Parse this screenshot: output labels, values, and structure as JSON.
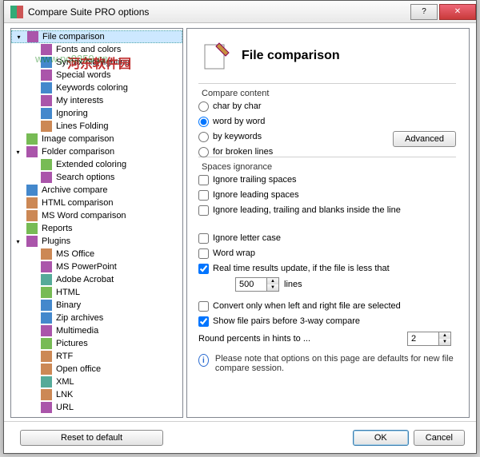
{
  "window": {
    "title": "Compare Suite PRO options"
  },
  "watermark": {
    "text": "www.pc0359.cn",
    "cn": "河东软件园"
  },
  "tree": [
    {
      "expand": "▾",
      "label": "File comparison",
      "lvl": 0,
      "sel": true
    },
    {
      "label": "Fonts and colors",
      "lvl": 1
    },
    {
      "label": "Syntax highlighting",
      "lvl": 1
    },
    {
      "label": "Special words",
      "lvl": 1
    },
    {
      "label": "Keywords coloring",
      "lvl": 1
    },
    {
      "label": "My interests",
      "lvl": 1
    },
    {
      "label": "Ignoring",
      "lvl": 1
    },
    {
      "label": "Lines Folding",
      "lvl": 1
    },
    {
      "label": "Image comparison",
      "lvl": 0
    },
    {
      "expand": "▾",
      "label": "Folder comparison",
      "lvl": 0
    },
    {
      "label": "Extended coloring",
      "lvl": 1
    },
    {
      "label": "Search options",
      "lvl": 1
    },
    {
      "label": "Archive compare",
      "lvl": 0
    },
    {
      "label": "HTML comparison",
      "lvl": 0
    },
    {
      "label": "MS Word comparison",
      "lvl": 0
    },
    {
      "label": "Reports",
      "lvl": 0
    },
    {
      "expand": "▾",
      "label": "Plugins",
      "lvl": 0
    },
    {
      "label": "MS Office",
      "lvl": 1
    },
    {
      "label": "MS PowerPoint",
      "lvl": 1
    },
    {
      "label": "Adobe Acrobat",
      "lvl": 1
    },
    {
      "label": "HTML",
      "lvl": 1
    },
    {
      "label": "Binary",
      "lvl": 1
    },
    {
      "label": "Zip archives",
      "lvl": 1
    },
    {
      "label": "Multimedia",
      "lvl": 1
    },
    {
      "label": "Pictures",
      "lvl": 1
    },
    {
      "label": "RTF",
      "lvl": 1
    },
    {
      "label": "Open office",
      "lvl": 1
    },
    {
      "label": "XML",
      "lvl": 1
    },
    {
      "label": "LNK",
      "lvl": 1
    },
    {
      "label": "URL",
      "lvl": 1
    }
  ],
  "pane": {
    "title": "File comparison",
    "compare_content": {
      "label": "Compare content",
      "options": [
        "char by char",
        "word by word",
        "by keywords",
        "for broken lines"
      ],
      "selected": 1,
      "advanced": "Advanced"
    },
    "spaces": {
      "label": "Spaces ignorance",
      "items": [
        "Ignore trailing spaces",
        "Ignore leading spaces",
        "Ignore leading, trailing and blanks inside the line"
      ]
    },
    "misc": {
      "ignore_case": "Ignore letter case",
      "word_wrap": "Word wrap",
      "realtime_label": "Real time results update, if the file is less that",
      "realtime_value": "500",
      "realtime_unit": "lines",
      "convert_only": "Convert only when left and right file are selected",
      "show_pairs": "Show file pairs before 3-way compare",
      "round_label": "Round percents in hints to ...",
      "round_value": "2"
    },
    "note": "Please note that options on this page are defaults for new file compare session."
  },
  "footer": {
    "reset": "Reset to default",
    "ok": "OK",
    "cancel": "Cancel"
  }
}
